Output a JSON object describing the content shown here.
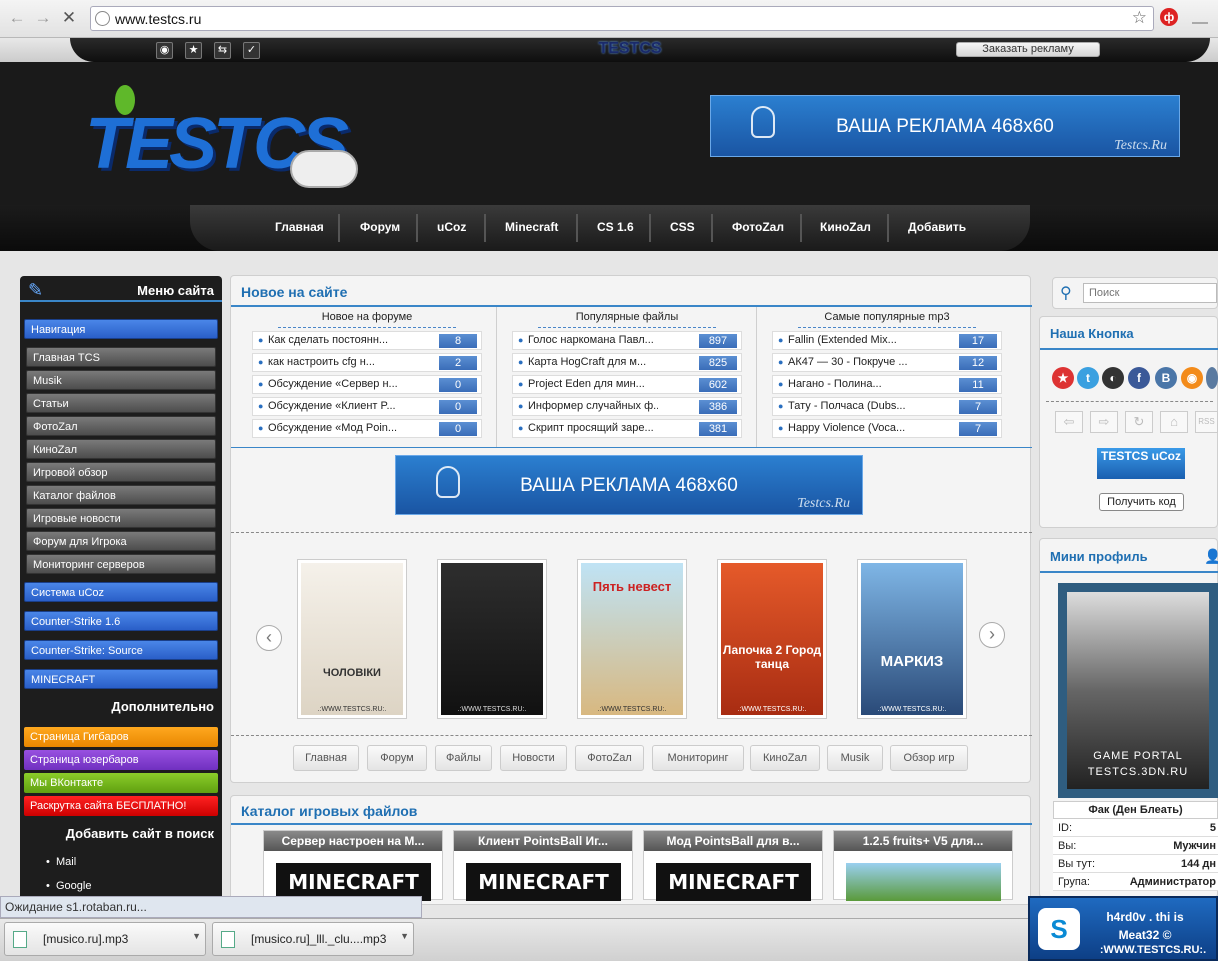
{
  "browser": {
    "url": "www.testcs.ru",
    "back_icon": "back-arrow-icon",
    "forward_icon": "forward-arrow-icon",
    "stop_icon": "stop-icon"
  },
  "topbar": {
    "logo": "TESTCS",
    "ad_link": "Заказать рекламу"
  },
  "header": {
    "banner_text": "ВАША РЕКЛАМА 468x60",
    "banner_sig": "Testcs.Ru"
  },
  "menu": [
    "Главная",
    "Форум",
    "uCoz",
    "Minecraft",
    "CS 1.6",
    "CSS",
    "ФотоZал",
    "КиноZал",
    "Добавить"
  ],
  "sidebar": {
    "title": "Меню сайта",
    "nav_label": "Навигация",
    "nav_items": [
      "Главная TCS",
      "Musik",
      "Статьи",
      "ФотоZал",
      "КиноZал",
      "Игровой обзор",
      "Каталог файлов",
      "Игровые новости",
      "Форум для Игрока",
      "Мониторинг серверов"
    ],
    "sections": [
      "Система uCoz",
      "Counter-Strike 1.6",
      "Counter-Strike: Source",
      "MINECRAFT"
    ],
    "extra_title": "Дополнительно",
    "extra_items": [
      "Страница Гигбаров",
      "Страница юзербаров",
      "Мы ВКонтакте",
      "Раскрутка сайта БЕСПЛАТНО!"
    ],
    "search_title": "Добавить сайт в поиск",
    "search_items": [
      "Mail",
      "Google"
    ]
  },
  "news": {
    "title": "Новое на сайте",
    "columns": [
      {
        "head": "Новое на форуме",
        "rows": [
          {
            "text": "Как сделать постоянн...",
            "count": "8"
          },
          {
            "text": "как настроить cfg н...",
            "count": "2"
          },
          {
            "text": "Обсуждение «Сервер н...",
            "count": "0"
          },
          {
            "text": "Обсуждение «Клиент P...",
            "count": "0"
          },
          {
            "text": "Обсуждение «Мод Poin...",
            "count": "0"
          }
        ]
      },
      {
        "head": "Популярные файлы",
        "rows": [
          {
            "text": "Голос наркомана Павл...",
            "count": "897"
          },
          {
            "text": "Карта HogCraft для м...",
            "count": "825"
          },
          {
            "text": "Project Eden для мин...",
            "count": "602"
          },
          {
            "text": "Информер случайных ф...",
            "count": "386"
          },
          {
            "text": "Скрипт просящий заре...",
            "count": "381"
          }
        ]
      },
      {
        "head": "Самые популярные mp3",
        "rows": [
          {
            "text": "Fallin (Extended Mix...",
            "count": "17"
          },
          {
            "text": "АК47 — 30 - Покруче ...",
            "count": "12"
          },
          {
            "text": "Нагано - Полина...",
            "count": "11"
          },
          {
            "text": "Тату - Полчаса (Dubs...",
            "count": "7"
          },
          {
            "text": "Happy Violence (Voca...",
            "count": "7"
          }
        ]
      }
    ],
    "posters": [
      {
        "title": "ЧОЛОВІКИ",
        "color": "#e8e4dc"
      },
      {
        "title": "",
        "color": "#2a2a2a"
      },
      {
        "title": "Пять невест",
        "color": "#d9c48a"
      },
      {
        "title": "Лапочка 2 Город танца",
        "color": "#c84a22"
      },
      {
        "title": "МАРКИЗ",
        "color": "#3a5a88"
      }
    ],
    "poster_footer": ".:WWW.TESTCS.RU:.",
    "tabs": [
      "Главная",
      "Форум",
      "Файлы",
      "Новости",
      "ФотоZал",
      "Мониторинг",
      "КиноZал",
      "Musik",
      "Обзор игр"
    ]
  },
  "catalog": {
    "title": "Каталог игровых файлов",
    "items": [
      "Сервер настроен на М...",
      "Клиент PointsBall Иг...",
      "Мод PointsBall для в...",
      "1.2.5 fruits+ V5 для..."
    ],
    "img_text": "MINECRAFT"
  },
  "right": {
    "search_placeholder": "Поиск",
    "button_title": "Наша Кнопка",
    "button_badge": "TESTCS uCoz",
    "get_code": "Получить код",
    "profile_title": "Мини профиль",
    "profile_caption1": "GAME PORTAL",
    "profile_caption2": "TESTCS.3DN.RU",
    "profile_name": "Фак (Ден Блеать)",
    "profile_rows": [
      {
        "k": "ID:",
        "v": "5"
      },
      {
        "k": "Вы:",
        "v": "Мужчин"
      },
      {
        "k": "Вы тут:",
        "v": "144 дн"
      },
      {
        "k": "Група:",
        "v": "Администратор"
      }
    ]
  },
  "status": "Ожидание s1.rotaban.ru...",
  "downloads": [
    "[musico.ru].mp3",
    "[musico.ru]_lll._clu....mp3"
  ],
  "skype": {
    "line1": "h4rd0v . thi is",
    "line2": "Meat32 ©",
    "line3": ":WWW.TESTCS.RU:."
  }
}
